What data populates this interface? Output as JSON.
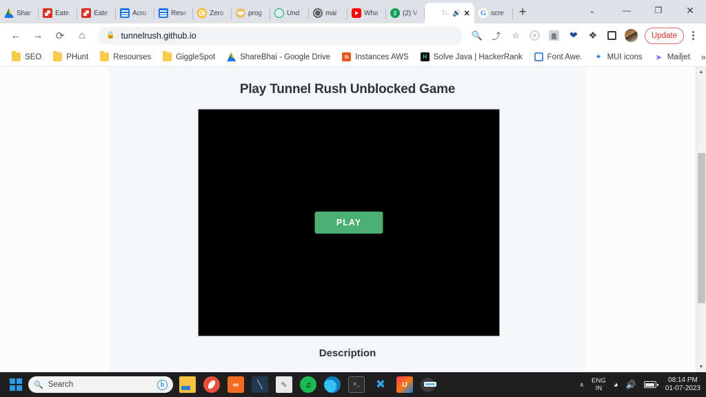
{
  "browser": {
    "tabs": [
      {
        "label": "Shar",
        "icon": "google-drive-icon",
        "favicon_class": "fi-drive",
        "active": false
      },
      {
        "label": "Eate",
        "icon": "red-doc-icon",
        "favicon_class": "fi-red",
        "active": false
      },
      {
        "label": "Eate",
        "icon": "red-doc-icon",
        "favicon_class": "fi-red",
        "active": false
      },
      {
        "label": "Acro",
        "icon": "blue-doc-icon",
        "favicon_class": "fi-blue",
        "active": false
      },
      {
        "label": "Rese",
        "icon": "blue-doc-icon",
        "favicon_class": "fi-blue",
        "active": false
      },
      {
        "label": "Zero",
        "icon": "zerogpt-icon",
        "favicon_class": "fi-zero",
        "glyph": "C",
        "active": false
      },
      {
        "label": "prog",
        "icon": "mail-icon",
        "favicon_class": "fi-mail",
        "active": false
      },
      {
        "label": "Und",
        "icon": "openai-icon",
        "favicon_class": "fi-gpt",
        "active": false
      },
      {
        "label": "mai",
        "icon": "globe-icon",
        "favicon_class": "fi-globe",
        "active": false
      },
      {
        "label": "Wha",
        "icon": "youtube-icon",
        "favicon_class": "fi-yt",
        "active": false
      },
      {
        "label": "(2) V",
        "icon": "notification-badge-icon",
        "favicon_class": "fi-badge",
        "glyph": "2",
        "active": false
      },
      {
        "label": "Tu",
        "icon": "tunnelrush-icon",
        "favicon_class": "fi-t",
        "active": true
      },
      {
        "label": "scre",
        "icon": "google-icon",
        "favicon_class": "fi-google",
        "glyph": "G",
        "active": false
      }
    ],
    "new_tab_label": "+",
    "window_controls": {
      "tab_search": "⌄",
      "minimize": "—",
      "maximize": "❐",
      "close": "✕"
    },
    "active_tab_controls": {
      "mute": "🔊",
      "close": "✕"
    },
    "toolbar": {
      "back": "←",
      "forward": "→",
      "reload": "⟳",
      "home": "⌂",
      "lock": "🔒",
      "url": "tunnelrush.github.io",
      "search_icon": "🔍",
      "share_icon": "⤴",
      "bookmark_icon": "☆",
      "update_label": "Update"
    },
    "bookmarks": [
      {
        "label": "SEO",
        "icon": "folder-icon",
        "icon_class": "folder"
      },
      {
        "label": "PHunt",
        "icon": "folder-icon",
        "icon_class": "folder"
      },
      {
        "label": "Resourses",
        "icon": "folder-icon",
        "icon_class": "folder"
      },
      {
        "label": "GiggleSpot",
        "icon": "folder-icon",
        "icon_class": "folder"
      },
      {
        "label": "ShareBhai - Google Drive",
        "icon": "google-drive-icon",
        "icon_class": "fi-drive"
      },
      {
        "label": "Instances AWS",
        "icon": "aws-icon",
        "icon_class": "bm-aws",
        "glyph": "⧉"
      },
      {
        "label": "Solve Java | HackerRank",
        "icon": "hackerrank-icon",
        "icon_class": "bm-hr",
        "glyph": "H"
      },
      {
        "label": "Font Awe.",
        "icon": "font-awesome-icon",
        "icon_class": "bm-fa"
      },
      {
        "label": "MUI icons",
        "icon": "mui-icon",
        "icon_class": "bm-mui",
        "glyph": "✦"
      },
      {
        "label": "Mailjet",
        "icon": "mailjet-icon",
        "icon_class": "bm-mj",
        "glyph": "➤"
      }
    ],
    "bookmarks_overflow": "»"
  },
  "page": {
    "title": "Play Tunnel Rush Unblocked Game",
    "play_button": "PLAY",
    "description_heading": "Description",
    "accent_green": "#4caf72",
    "game_background": "#000000"
  },
  "taskbar": {
    "start_label": "Start",
    "search_placeholder": "Search",
    "apps": [
      {
        "name": "file-explorer",
        "class": "a-explorer",
        "glyph": ""
      },
      {
        "name": "opera",
        "class": "a-opera",
        "glyph": ""
      },
      {
        "name": "xampp",
        "class": "a-xampp",
        "glyph": "∞"
      },
      {
        "name": "blue-tool",
        "class": "a-tool",
        "glyph": "╲"
      },
      {
        "name": "paint",
        "class": "a-paint",
        "glyph": "✎"
      },
      {
        "name": "spotify",
        "class": "a-spotify",
        "glyph": "♫"
      },
      {
        "name": "microsoft-edge",
        "class": "a-edge",
        "glyph": ""
      },
      {
        "name": "terminal",
        "class": "a-term",
        "glyph": ">_"
      },
      {
        "name": "vs-code",
        "class": "a-vscode",
        "glyph": "✖"
      },
      {
        "name": "intellij-idea",
        "class": "a-idea",
        "glyph": "IJ"
      },
      {
        "name": "google-chrome",
        "class": "a-chrome",
        "glyph": "",
        "active": true
      }
    ],
    "tray": {
      "chevron": "∧",
      "language": "ENG",
      "region": "IN",
      "wifi": "◠",
      "volume": "🔊",
      "time": "08:14 PM",
      "date": "01-07-2023"
    }
  },
  "scrollbar": {
    "up_arrow": "▲",
    "down_arrow": "▼"
  }
}
